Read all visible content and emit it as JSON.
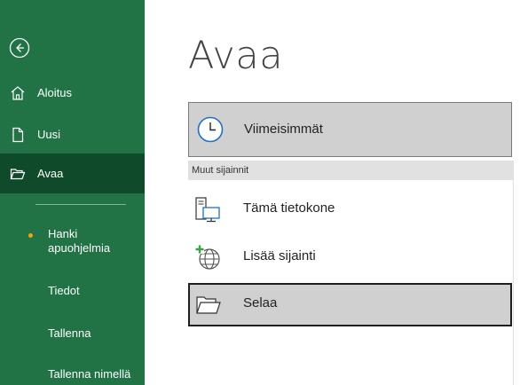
{
  "colors": {
    "sidebar_bg": "#217346",
    "sidebar_active": "#0f4a2a",
    "bullet": "#f0a30a"
  },
  "sidebar": {
    "back_icon": "back-arrow-icon",
    "items": [
      {
        "label": "Aloitus",
        "icon": "home-icon"
      },
      {
        "label": "Uusi",
        "icon": "new-file-icon"
      },
      {
        "label": "Avaa",
        "icon": "open-folder-icon",
        "active": true
      }
    ],
    "sub_items": [
      {
        "label": "Hanki apuohjelmia",
        "bullet": true
      },
      {
        "label": "Tiedot"
      },
      {
        "label": "Tallenna"
      },
      {
        "label": "Tallenna nimellä"
      }
    ]
  },
  "main": {
    "title": "Avaa",
    "recent_label": "Viimeisimmät",
    "section_header": "Muut sijainnit",
    "locations": [
      {
        "label": "Tämä tietokone",
        "icon": "this-pc-icon"
      },
      {
        "label": "Lisää sijainti",
        "icon": "add-location-globe-icon"
      },
      {
        "label": "Selaa",
        "icon": "browse-folder-icon",
        "selected": true
      }
    ]
  }
}
